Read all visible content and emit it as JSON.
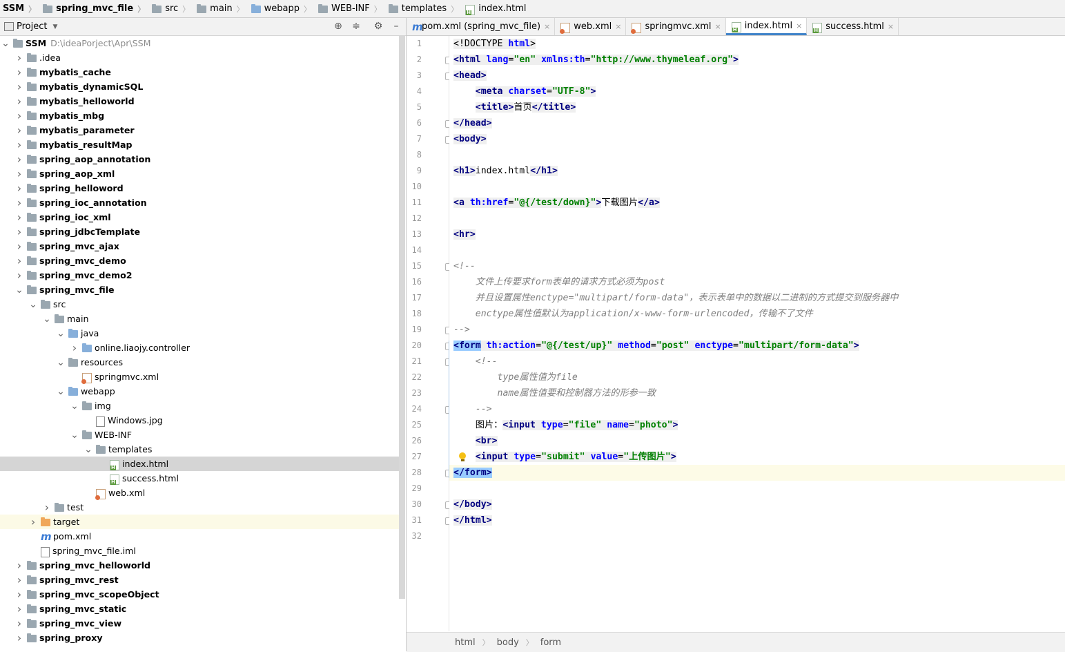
{
  "breadcrumb": [
    {
      "label": "SSM",
      "icon": "none"
    },
    {
      "label": "spring_mvc_file",
      "icon": "module-folder-icon"
    },
    {
      "label": "src",
      "icon": "folder-icon"
    },
    {
      "label": "main",
      "icon": "folder-icon"
    },
    {
      "label": "webapp",
      "icon": "web-folder-icon"
    },
    {
      "label": "WEB-INF",
      "icon": "folder-icon"
    },
    {
      "label": "templates",
      "icon": "folder-icon"
    },
    {
      "label": "index.html",
      "icon": "html-file-icon"
    }
  ],
  "project_panel": {
    "title": "Project",
    "tree": [
      {
        "label": "SSM",
        "path": "D:\\ideaPorject\\Apr\\SSM",
        "depth": 0,
        "expanded": true,
        "bold": true,
        "icon": "module-folder-icon"
      },
      {
        "label": ".idea",
        "depth": 1,
        "expanded": false,
        "bold": false,
        "icon": "folder-icon"
      },
      {
        "label": "mybatis_cache",
        "depth": 1,
        "expanded": false,
        "bold": true,
        "icon": "module-folder-icon"
      },
      {
        "label": "mybatis_dynamicSQL",
        "depth": 1,
        "expanded": false,
        "bold": true,
        "icon": "module-folder-icon"
      },
      {
        "label": "mybatis_helloworld",
        "depth": 1,
        "expanded": false,
        "bold": true,
        "icon": "module-folder-icon"
      },
      {
        "label": "mybatis_mbg",
        "depth": 1,
        "expanded": false,
        "bold": true,
        "icon": "module-folder-icon"
      },
      {
        "label": "mybatis_parameter",
        "depth": 1,
        "expanded": false,
        "bold": true,
        "icon": "module-folder-icon"
      },
      {
        "label": "mybatis_resultMap",
        "depth": 1,
        "expanded": false,
        "bold": true,
        "icon": "module-folder-icon"
      },
      {
        "label": "spring_aop_annotation",
        "depth": 1,
        "expanded": false,
        "bold": true,
        "icon": "module-folder-icon"
      },
      {
        "label": "spring_aop_xml",
        "depth": 1,
        "expanded": false,
        "bold": true,
        "icon": "module-folder-icon"
      },
      {
        "label": "spring_helloword",
        "depth": 1,
        "expanded": false,
        "bold": true,
        "icon": "module-folder-icon"
      },
      {
        "label": "spring_ioc_annotation",
        "depth": 1,
        "expanded": false,
        "bold": true,
        "icon": "module-folder-icon"
      },
      {
        "label": "spring_ioc_xml",
        "depth": 1,
        "expanded": false,
        "bold": true,
        "icon": "module-folder-icon"
      },
      {
        "label": "spring_jdbcTemplate",
        "depth": 1,
        "expanded": false,
        "bold": true,
        "icon": "module-folder-icon"
      },
      {
        "label": "spring_mvc_ajax",
        "depth": 1,
        "expanded": false,
        "bold": true,
        "icon": "module-folder-icon"
      },
      {
        "label": "spring_mvc_demo",
        "depth": 1,
        "expanded": false,
        "bold": true,
        "icon": "module-folder-icon"
      },
      {
        "label": "spring_mvc_demo2",
        "depth": 1,
        "expanded": false,
        "bold": true,
        "icon": "module-folder-icon"
      },
      {
        "label": "spring_mvc_file",
        "depth": 1,
        "expanded": true,
        "bold": true,
        "icon": "module-folder-icon"
      },
      {
        "label": "src",
        "depth": 2,
        "expanded": true,
        "bold": false,
        "icon": "folder-icon"
      },
      {
        "label": "main",
        "depth": 3,
        "expanded": true,
        "bold": false,
        "icon": "folder-icon"
      },
      {
        "label": "java",
        "depth": 4,
        "expanded": true,
        "bold": false,
        "icon": "source-folder-icon"
      },
      {
        "label": "online.liaojy.controller",
        "depth": 5,
        "expanded": false,
        "bold": false,
        "icon": "package-icon"
      },
      {
        "label": "resources",
        "depth": 4,
        "expanded": true,
        "bold": false,
        "icon": "resources-folder-icon"
      },
      {
        "label": "springmvc.xml",
        "depth": 5,
        "leaf": true,
        "bold": false,
        "icon": "xml-file-icon"
      },
      {
        "label": "webapp",
        "depth": 4,
        "expanded": true,
        "bold": false,
        "icon": "web-folder-icon"
      },
      {
        "label": "img",
        "depth": 5,
        "expanded": true,
        "bold": false,
        "icon": "folder-icon"
      },
      {
        "label": "Windows.jpg",
        "depth": 6,
        "leaf": true,
        "bold": false,
        "icon": "image-file-icon"
      },
      {
        "label": "WEB-INF",
        "depth": 5,
        "expanded": true,
        "bold": false,
        "icon": "folder-icon"
      },
      {
        "label": "templates",
        "depth": 6,
        "expanded": true,
        "bold": false,
        "icon": "folder-icon"
      },
      {
        "label": "index.html",
        "depth": 7,
        "leaf": true,
        "bold": false,
        "icon": "html-file-icon",
        "selected": true
      },
      {
        "label": "success.html",
        "depth": 7,
        "leaf": true,
        "bold": false,
        "icon": "html-file-icon"
      },
      {
        "label": "web.xml",
        "depth": 6,
        "leaf": true,
        "bold": false,
        "icon": "xml-file-icon"
      },
      {
        "label": "test",
        "depth": 3,
        "expanded": false,
        "bold": false,
        "icon": "folder-icon"
      },
      {
        "label": "target",
        "depth": 2,
        "expanded": false,
        "bold": false,
        "icon": "excluded-folder-icon",
        "highlight": true
      },
      {
        "label": "pom.xml",
        "depth": 2,
        "leaf": true,
        "bold": false,
        "icon": "maven-file-icon"
      },
      {
        "label": "spring_mvc_file.iml",
        "depth": 2,
        "leaf": true,
        "bold": false,
        "icon": "iml-file-icon"
      },
      {
        "label": "spring_mvc_helloworld",
        "depth": 1,
        "expanded": false,
        "bold": true,
        "icon": "module-folder-icon"
      },
      {
        "label": "spring_mvc_rest",
        "depth": 1,
        "expanded": false,
        "bold": true,
        "icon": "module-folder-icon"
      },
      {
        "label": "spring_mvc_scopeObject",
        "depth": 1,
        "expanded": false,
        "bold": true,
        "icon": "module-folder-icon"
      },
      {
        "label": "spring_mvc_static",
        "depth": 1,
        "expanded": false,
        "bold": true,
        "icon": "module-folder-icon"
      },
      {
        "label": "spring_mvc_view",
        "depth": 1,
        "expanded": false,
        "bold": true,
        "icon": "module-folder-icon"
      },
      {
        "label": "spring_proxy",
        "depth": 1,
        "expanded": false,
        "bold": true,
        "icon": "module-folder-icon"
      }
    ]
  },
  "tabs": [
    {
      "label": "pom.xml (spring_mvc_file)",
      "icon": "maven-file-icon",
      "active": false
    },
    {
      "label": "web.xml",
      "icon": "xml-file-icon",
      "active": false
    },
    {
      "label": "springmvc.xml",
      "icon": "xml-file-icon",
      "active": false
    },
    {
      "label": "index.html",
      "icon": "html-file-icon",
      "active": true
    },
    {
      "label": "success.html",
      "icon": "html-file-icon",
      "active": false
    }
  ],
  "editor": {
    "current_line": 28,
    "lines": [
      "<!DOCTYPE html>",
      "<html lang=\"en\" xmlns:th=\"http://www.thymeleaf.org\">",
      "<head>",
      "    <meta charset=\"UTF-8\">",
      "    <title>首页</title>",
      "</head>",
      "<body>",
      "",
      "<h1>index.html</h1>",
      "",
      "<a th:href=\"@{/test/down}\">下载图片</a>",
      "",
      "<hr>",
      "",
      "<!--",
      "    文件上传要求form表单的请求方式必须为post",
      "    并且设置属性enctype=\"multipart/form-data\"，表示表单中的数据以二进制的方式提交到服务器中",
      "    enctype属性值默认为application/x-www-form-urlencoded，传输不了文件",
      "-->",
      "<form th:action=\"@{/test/up}\" method=\"post\" enctype=\"multipart/form-data\">",
      "    <!--",
      "        type属性值为file",
      "        name属性值要和控制器方法的形参一致",
      "    -->",
      "    图片：<input type=\"file\" name=\"photo\">",
      "    <br>",
      "    <input type=\"submit\" value=\"上传图片\">",
      "</form>",
      "",
      "</body>",
      "</html>",
      ""
    ]
  },
  "statusbar": {
    "crumbs": [
      "html",
      "body",
      "form"
    ]
  }
}
